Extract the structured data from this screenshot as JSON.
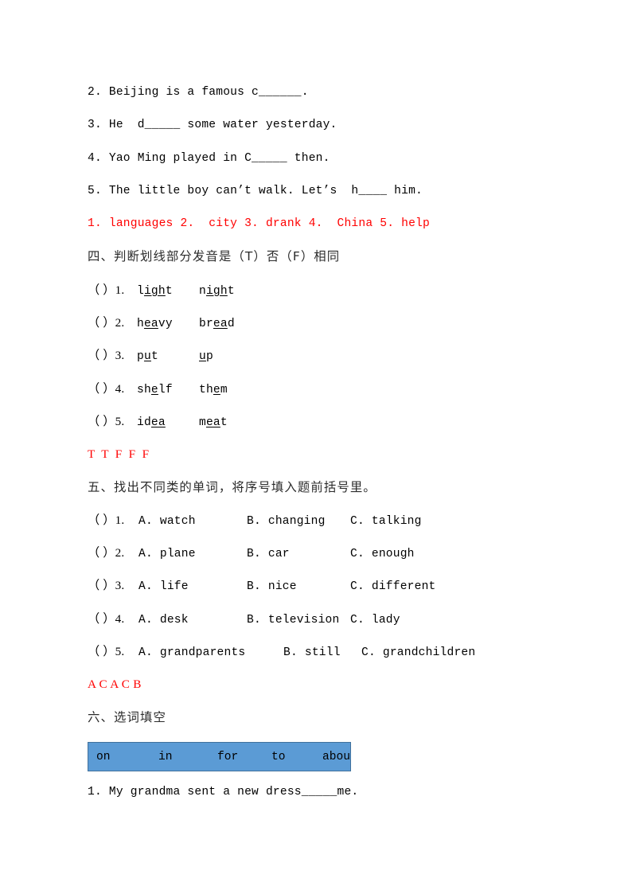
{
  "page": {
    "background_color": "#ffffff",
    "answer_color": "#ff0000",
    "wordbank_fill": "#5b9bd5",
    "wordbank_border": "#41719c"
  },
  "fill_in_blanks": {
    "items": [
      "2. Beijing is a famous c______.",
      "3. He  d_____ some water yesterday.",
      "4. Yao Ming played in C_____ then.",
      "5. The little boy can’t walk. Let’s  h____ him."
    ],
    "answers": "1. languages 2.  city 3. drank 4.  China 5. help"
  },
  "section_four": {
    "heading": "四、判断划线部分发音是（T）否（F）相同",
    "items": [
      {
        "lead": "（ ）1.",
        "word_a_pre": "l",
        "word_a_mid": "igh",
        "word_a_post": "t",
        "word_b_pre": "n",
        "word_b_mid": "igh",
        "word_b_post": "t"
      },
      {
        "lead": "（ ）2.",
        "word_a_pre": "h",
        "word_a_mid": "ea",
        "word_a_post": "vy",
        "word_b_pre": "br",
        "word_b_mid": "ea",
        "word_b_post": "d"
      },
      {
        "lead": "（ ）3.",
        "word_a_pre": "p",
        "word_a_mid": "u",
        "word_a_post": "t",
        "word_b_pre": "",
        "word_b_mid": "u",
        "word_b_post": "p"
      },
      {
        "lead": "（ ）4.",
        "word_a_pre": "sh",
        "word_a_mid": "e",
        "word_a_post": "lf",
        "word_b_pre": "th",
        "word_b_mid": "e",
        "word_b_post": "m"
      },
      {
        "lead": "（ ）5.",
        "word_a_pre": "id",
        "word_a_mid": "ea",
        "word_a_post": "",
        "word_b_pre": "m",
        "word_b_mid": "ea",
        "word_b_post": "t"
      }
    ],
    "answers": "T  T  F  F  F"
  },
  "section_five": {
    "heading": "五、找出不同类的单词，将序号填入题前括号里。",
    "items": [
      {
        "lead": "（ ）1.",
        "a": "A. watch",
        "b": "B. changing",
        "c": "C. talking"
      },
      {
        "lead": "（ ）2.",
        "a": "A. plane",
        "b": "B. car",
        "c": "C. enough"
      },
      {
        "lead": "（ ）3.",
        "a": "A. life",
        "b": "B. nice",
        "c": "C. different"
      },
      {
        "lead": "（ ）4.",
        "a": "A. desk",
        "b": "B. television",
        "c": "C. lady"
      },
      {
        "lead": "（ ）5.",
        "a": "A. grandparents",
        "b": "B. still",
        "c": "C. grandchildren"
      }
    ],
    "answers": "A C A C B"
  },
  "section_six": {
    "heading": "六、选词填空",
    "wordbank": [
      "on",
      "in",
      "for",
      "to",
      "about"
    ],
    "items": [
      "1. My grandma sent a new dress_____me."
    ]
  }
}
